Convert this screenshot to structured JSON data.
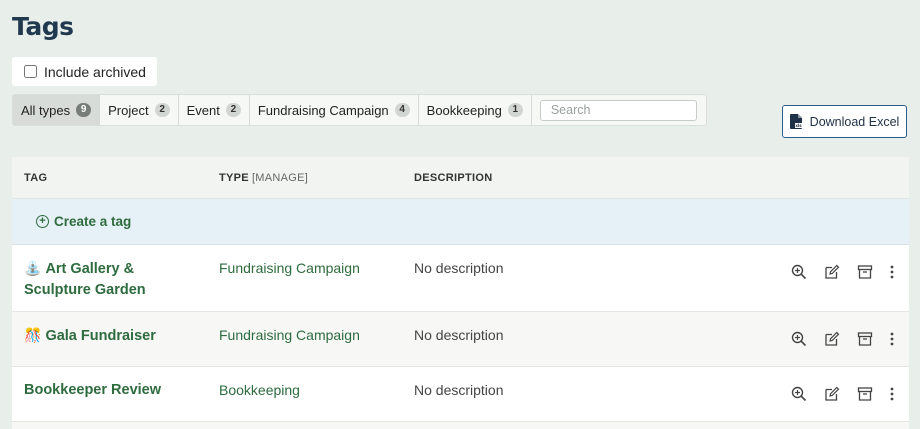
{
  "page": {
    "title": "Tags"
  },
  "archived": {
    "label": "Include archived",
    "checked": false
  },
  "filters": [
    {
      "label": "All types",
      "count": "9",
      "active": true
    },
    {
      "label": "Project",
      "count": "2",
      "active": false
    },
    {
      "label": "Event",
      "count": "2",
      "active": false
    },
    {
      "label": "Fundraising Campaign",
      "count": "4",
      "active": false
    },
    {
      "label": "Bookkeeping",
      "count": "1",
      "active": false
    }
  ],
  "search": {
    "placeholder": "Search",
    "value": ""
  },
  "download": {
    "label": "Download Excel"
  },
  "table": {
    "headers": {
      "tag": "TAG",
      "type": "TYPE",
      "manage": "[MANAGE]",
      "description": "DESCRIPTION"
    },
    "create_label": "Create a tag",
    "rows": [
      {
        "emoji": "⛲",
        "tag": "Art Gallery & Sculpture Garden",
        "type": "Fundraising Campaign",
        "description": "No description"
      },
      {
        "emoji": "🎊",
        "tag": "Gala Fundraiser",
        "type": "Fundraising Campaign",
        "description": "No description"
      },
      {
        "emoji": "",
        "tag": "Bookkeeper Review",
        "type": "Bookkeeping",
        "description": "No description"
      }
    ]
  },
  "colors": {
    "accent_green": "#2e6b3e",
    "title_navy": "#21394f",
    "button_border": "#2d5c8f",
    "create_row_bg": "#e5f0f7"
  },
  "icons": [
    "zoom-icon",
    "edit-icon",
    "archive-icon",
    "more-icon",
    "excel-icon",
    "plus-circle-icon"
  ]
}
